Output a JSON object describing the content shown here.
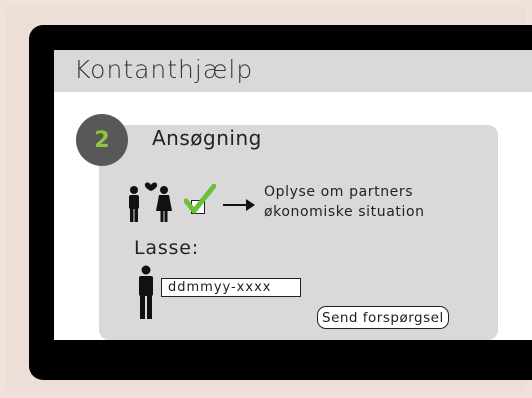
{
  "app": {
    "title": "Kontanthjælp"
  },
  "step": {
    "number": "2",
    "title": "Ansøgning"
  },
  "partner": {
    "line1": "Oplyse om partners",
    "line2": "økonomiske situation"
  },
  "person": {
    "name": "Lasse:",
    "cpr_placeholder": "ddmmyy-xxxx"
  },
  "actions": {
    "send_label": "Send forspørgsel"
  },
  "colors": {
    "accent": "#8dc63f",
    "panel": "#d9d9d9",
    "badge": "#585858"
  }
}
